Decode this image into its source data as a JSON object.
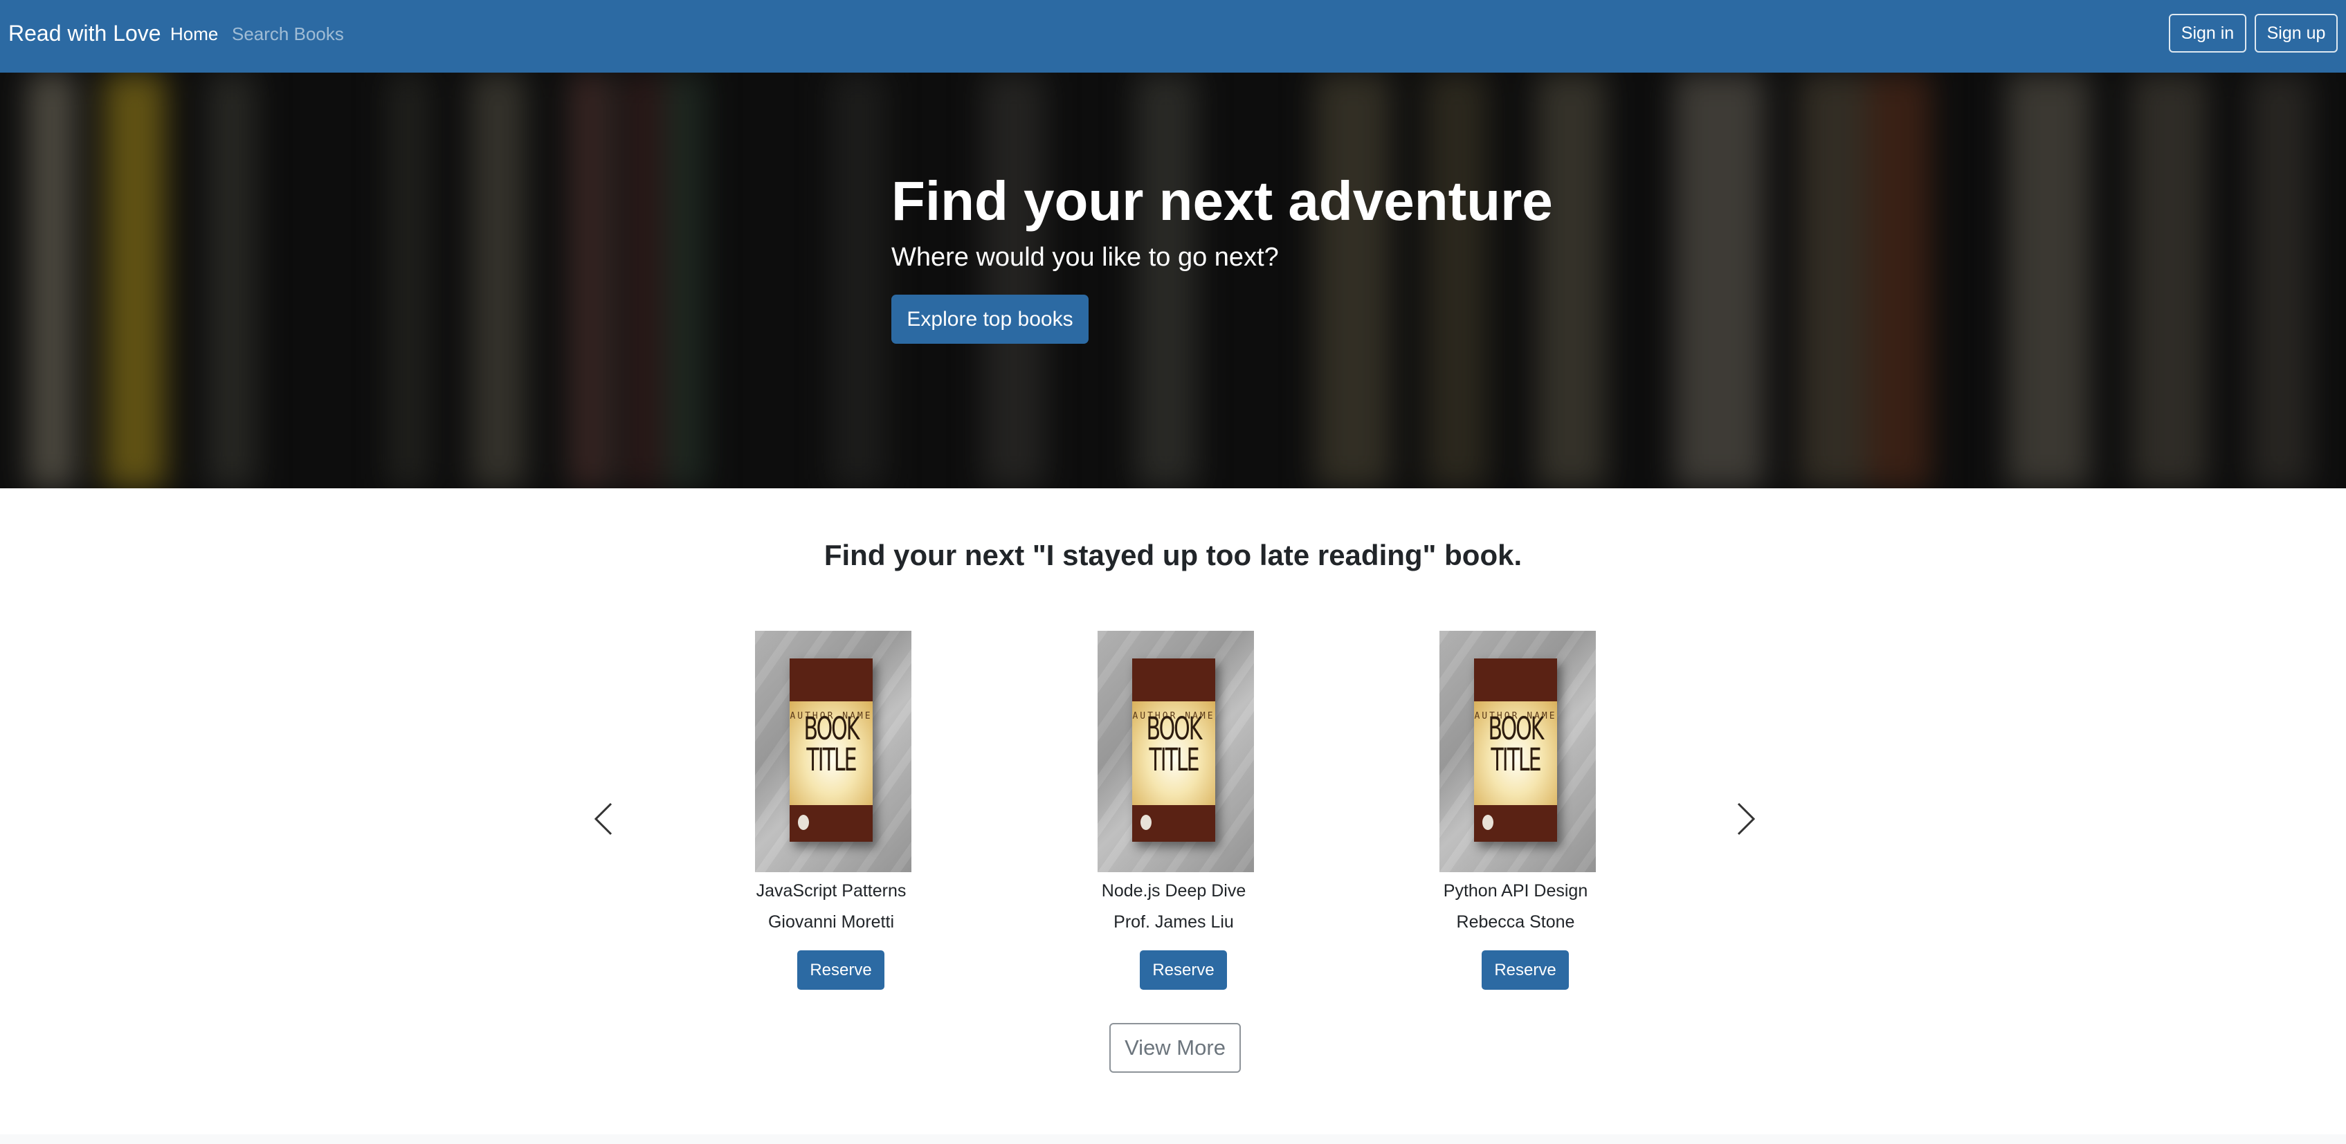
{
  "navbar": {
    "brand": "Read with Love",
    "links": [
      {
        "label": "Home",
        "active": true
      },
      {
        "label": "Search Books",
        "active": false
      }
    ],
    "sign_in_label": "Sign in",
    "sign_up_label": "Sign up",
    "bg_color": "#2c6aa3"
  },
  "hero": {
    "title": "Find your next adventure",
    "subtitle": "Where would you like to go next?",
    "cta_label": "Explore top books"
  },
  "section": {
    "heading": "Find your next \"I stayed up too late reading\" book."
  },
  "carousel": {
    "prev_icon": "chevron-left-icon",
    "next_icon": "chevron-right-icon",
    "books": [
      {
        "title": "JavaScript Patterns",
        "author": "Giovanni Moretti",
        "reserve_label": "Reserve",
        "cover_author": "AUTHOR NAME",
        "cover_title": "BOOK TITLE"
      },
      {
        "title": "Node.js Deep Dive",
        "author": "Prof. James Liu",
        "reserve_label": "Reserve",
        "cover_author": "AUTHOR NAME",
        "cover_title": "BOOK TITLE"
      },
      {
        "title": "Python API Design",
        "author": "Rebecca Stone",
        "reserve_label": "Reserve",
        "cover_author": "AUTHOR NAME",
        "cover_title": "BOOK TITLE"
      }
    ]
  },
  "view_more_label": "View More",
  "colors": {
    "primary": "#2c6aa3",
    "hero_dark": "#141414",
    "outline_gray": "#8d9399"
  }
}
